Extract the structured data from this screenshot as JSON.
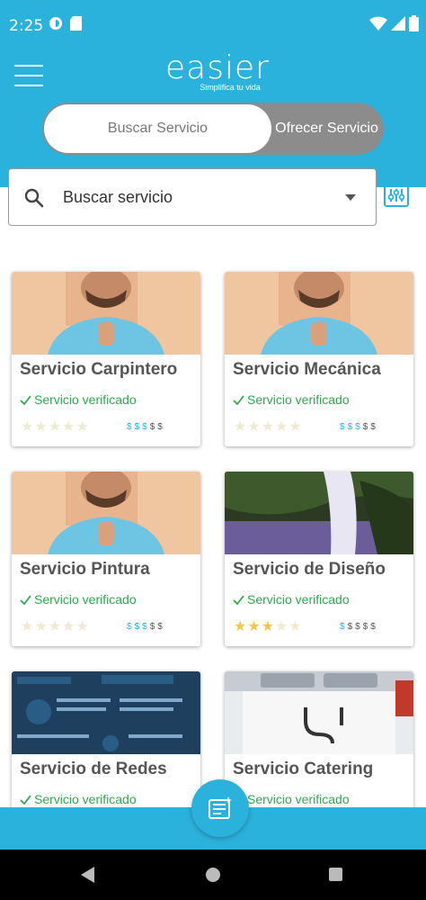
{
  "status": {
    "time": "2:25"
  },
  "header": {
    "logo": "easier",
    "tagline": "Simplifica tu vida"
  },
  "toggle": {
    "active": "Buscar Servicio",
    "inactive": "Ofrecer Servicio"
  },
  "search": {
    "placeholder": "Buscar servicio"
  },
  "colors": {
    "brand": "#2bb2dc",
    "verified": "#2fa84f",
    "star": "#f6c744"
  },
  "cards": [
    {
      "title": "Servicio Carpintero",
      "verified": "Servicio verificado",
      "rating": 0,
      "price_level": 3,
      "price_symbols": "$$$$$",
      "image": "smiling-man-thumbs-up"
    },
    {
      "title": "Servicio Mecánica",
      "verified": "Servicio verificado",
      "rating": 0,
      "price_level": 3,
      "price_symbols": "$$$$$",
      "image": "smiling-man-thumbs-up"
    },
    {
      "title": "Servicio Pintura",
      "verified": "Servicio verificado",
      "rating": 0,
      "price_level": 3,
      "price_symbols": "$$$$$",
      "image": "smiling-man-thumbs-up"
    },
    {
      "title": "Servicio de Diseño",
      "verified": "Servicio verificado",
      "rating": 3,
      "price_level": 1,
      "price_symbols": "$$$$$",
      "image": "waterfall"
    },
    {
      "title": "Servicio de Redes",
      "verified": "Servicio verificado",
      "rating": 0,
      "price_level": 0,
      "price_symbols": "$$$$$",
      "image": "infographic"
    },
    {
      "title": "Servicio Catering",
      "verified": "Servicio verificado",
      "rating": 0,
      "price_level": 0,
      "price_symbols": "$$$$$",
      "image": "kitchen-sink"
    }
  ]
}
